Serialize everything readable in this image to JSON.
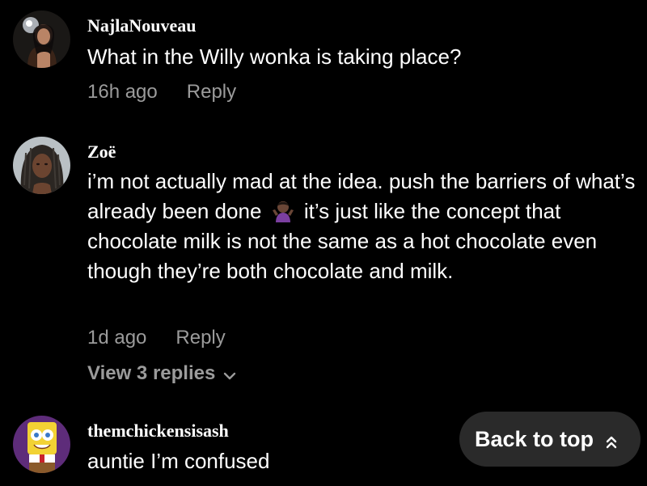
{
  "comments": [
    {
      "username": "NajlaNouveau",
      "text": "What in the Willy wonka is taking place?",
      "time": "16h ago",
      "reply_label": "Reply"
    },
    {
      "username": "Zoë",
      "text_before_emoji": "i’m not actually mad at the idea. push the barriers of what’s already been done",
      "emoji": "person-shrugging-emoji",
      "text_after_emoji": "it’s just like the concept that chocolate milk is not the same as a hot chocolate even though they’re both chocolate and milk.",
      "time": "1d ago",
      "reply_label": "Reply",
      "view_replies_label": "View 3 replies"
    },
    {
      "username": "themchickensisash",
      "text": "auntie I’m confused"
    }
  ],
  "back_to_top": {
    "label": "Back to top",
    "icon": "double-chevron-up-icon"
  },
  "colors": {
    "background": "#000000",
    "text": "#ffffff",
    "muted": "#9b9b9b",
    "button_bg": "#2a2a2a"
  }
}
